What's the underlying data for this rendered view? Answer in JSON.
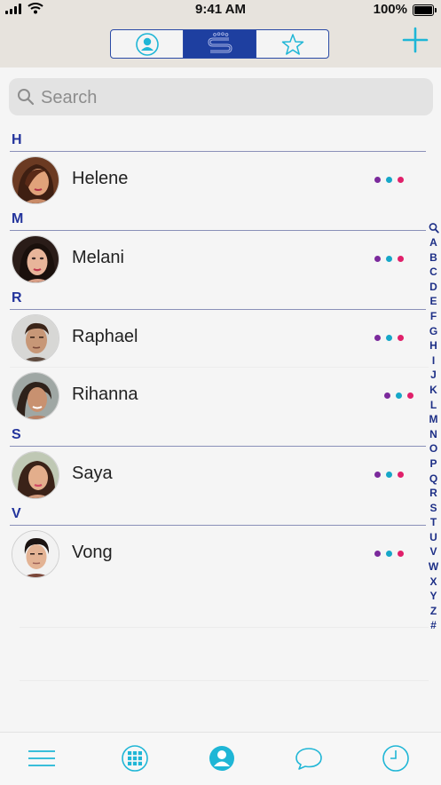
{
  "status": {
    "time": "9:41 AM",
    "battery": "100%"
  },
  "header": {
    "segments": [
      {
        "icon": "contact-icon",
        "active": false
      },
      {
        "icon": "s-logo-icon",
        "active": true
      },
      {
        "icon": "star-icon",
        "active": false
      }
    ],
    "add_icon": "plus-icon"
  },
  "search": {
    "placeholder": "Search",
    "value": ""
  },
  "sections": [
    {
      "letter": "H",
      "contacts": [
        {
          "name": "Helene"
        }
      ]
    },
    {
      "letter": "M",
      "contacts": [
        {
          "name": "Melani"
        }
      ]
    },
    {
      "letter": "R",
      "contacts": [
        {
          "name": "Raphael"
        },
        {
          "name": "Rihanna"
        }
      ]
    },
    {
      "letter": "S",
      "contacts": [
        {
          "name": "Saya"
        }
      ]
    },
    {
      "letter": "V",
      "contacts": [
        {
          "name": "Vong"
        }
      ]
    }
  ],
  "index": [
    "A",
    "B",
    "C",
    "D",
    "E",
    "F",
    "G",
    "H",
    "I",
    "J",
    "K",
    "L",
    "M",
    "N",
    "O",
    "P",
    "Q",
    "R",
    "S",
    "T",
    "U",
    "V",
    "W",
    "X",
    "Y",
    "Z",
    "#"
  ],
  "tabs": [
    "menu-icon",
    "keypad-icon",
    "contacts-icon",
    "chat-icon",
    "clock-icon"
  ],
  "colors": {
    "accent": "#1fb6d6",
    "brand": "#1e3fa0",
    "section_letter": "#23349c",
    "dot_purple": "#7b2a9c",
    "dot_teal": "#16a7c8",
    "dot_pink": "#e0206a"
  }
}
